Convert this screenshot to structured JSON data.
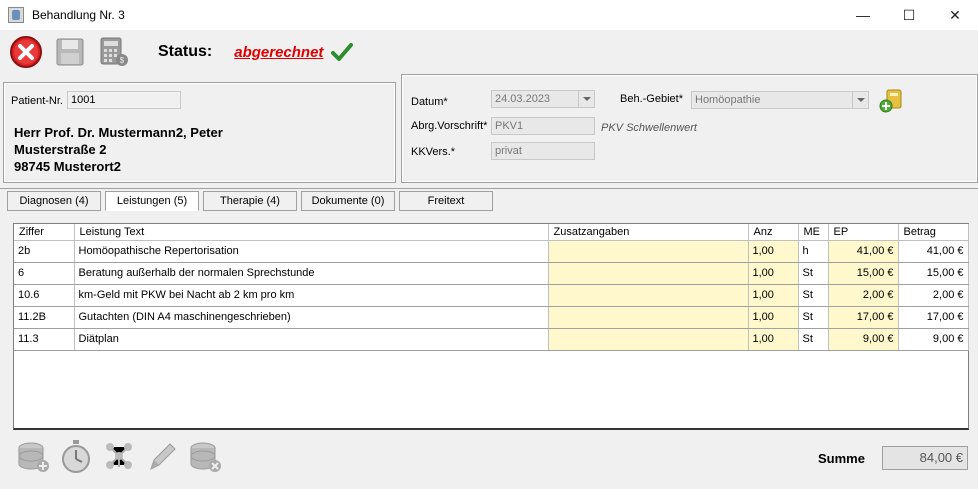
{
  "window": {
    "title": "Behandlung Nr. 3",
    "minimize": "—",
    "maximize": "☐",
    "close": "✕"
  },
  "toolbar": {
    "status_label": "Status:",
    "status_value": "abgerechnet"
  },
  "patient": {
    "nr_label": "Patient-Nr.",
    "nr_value": "1001",
    "name": "Herr Prof. Dr. Mustermann2, Peter",
    "street": "Musterstraße 2",
    "city": "98745 Musterort2"
  },
  "details": {
    "datum_label": "Datum*",
    "datum_value": "24.03.2023",
    "gebiet_label": "Beh.-Gebiet*",
    "gebiet_value": "Homöopathie",
    "abrg_label": "Abrg.Vorschrift*",
    "abrg_value": "PKV1",
    "abrg_hint": "PKV Schwellenwert",
    "kkvers_label": "KKVers.*",
    "kkvers_value": "privat"
  },
  "tabs": [
    {
      "label": "Diagnosen (4)"
    },
    {
      "label": "Leistungen (5)"
    },
    {
      "label": "Therapie (4)"
    },
    {
      "label": "Dokumente (0)"
    },
    {
      "label": "Freitext"
    }
  ],
  "table": {
    "headers": [
      "Ziffer",
      "Leistung Text",
      "Zusatzangaben",
      "Anz",
      "ME",
      "EP",
      "Betrag"
    ],
    "rows": [
      {
        "ziffer": "2b",
        "text": "Homöopathische Repertorisation",
        "zusatz": "",
        "anz": "1,00",
        "me": "h",
        "ep": "41,00 €",
        "betrag": "41,00 €"
      },
      {
        "ziffer": "6",
        "text": "Beratung außerhalb der normalen Sprechstunde",
        "zusatz": "",
        "anz": "1,00",
        "me": "St",
        "ep": "15,00 €",
        "betrag": "15,00 €"
      },
      {
        "ziffer": "10.6",
        "text": "km-Geld mit PKW bei Nacht ab 2 km pro km",
        "zusatz": "",
        "anz": "1,00",
        "me": "St",
        "ep": "2,00 €",
        "betrag": "2,00 €"
      },
      {
        "ziffer": "11.2B",
        "text": "Gutachten (DIN A4 maschinengeschrieben)",
        "zusatz": "",
        "anz": "1,00",
        "me": "St",
        "ep": "17,00 €",
        "betrag": "17,00 €"
      },
      {
        "ziffer": "11.3",
        "text": "Diätplan",
        "zusatz": "",
        "anz": "1,00",
        "me": "St",
        "ep": "9,00 €",
        "betrag": "9,00 €"
      }
    ]
  },
  "summary": {
    "summe_label": "Summe",
    "summe_value": "84,00 €"
  },
  "icons": [
    "cancel-icon",
    "save-icon",
    "calculator-icon",
    "checkmark-icon",
    "add-insurance-icon",
    "coins-add-icon",
    "stopwatch-icon",
    "network-icon",
    "pencil-icon",
    "coins-remove-icon"
  ],
  "colors": {
    "status_red": "#e00000",
    "check_green": "#2e8b2e",
    "yellow_cell": "#fff8cc"
  }
}
